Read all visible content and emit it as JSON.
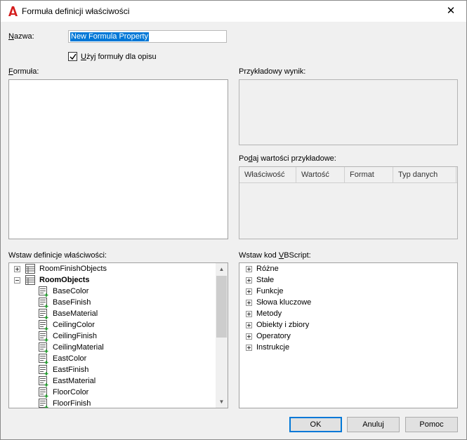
{
  "window": {
    "title": "Formuła definicji właściwości"
  },
  "name": {
    "label_accel": "N",
    "label_rest": "azwa:",
    "value": "New Formula Property"
  },
  "use_formula": {
    "label_accel": "U",
    "label_rest": "żyj formuły dla opisu",
    "checked": true
  },
  "formula": {
    "label_accel": "F",
    "label_rest": "ormuła:"
  },
  "sample_result": {
    "label": "Przykładowy wynik:"
  },
  "sample_values": {
    "label_pre": "Po",
    "label_accel": "d",
    "label_post": "aj wartości przykładowe:",
    "columns": [
      "Właściwość",
      "Wartość",
      "Format",
      "Typ danych"
    ]
  },
  "insert_property": {
    "label": "Wstaw definicje właściwości:",
    "objects": [
      {
        "label": "RoomFinishObjects",
        "expanded": false
      },
      {
        "label": "RoomObjects",
        "expanded": true
      }
    ],
    "properties": [
      "BaseColor",
      "BaseFinish",
      "BaseMaterial",
      "CeilingColor",
      "CeilingFinish",
      "CeilingMaterial",
      "EastColor",
      "EastFinish",
      "EastMaterial",
      "FloorColor",
      "FloorFinish"
    ]
  },
  "vbscript": {
    "label_pre": "Wstaw kod ",
    "label_accel": "V",
    "label_post": "BScript:",
    "items": [
      "Różne",
      "Stałe",
      "Funkcje",
      "Słowa kluczowe",
      "Metody",
      "Obiekty i zbiory",
      "Operatory",
      "Instrukcje"
    ]
  },
  "buttons": {
    "ok": "OK",
    "cancel": "Anuluj",
    "help": "Pomoc"
  },
  "colors": {
    "selection": "#0078d7",
    "app_icon": "#d41c1c",
    "prop_icon_plus": "#1f9b2a"
  }
}
